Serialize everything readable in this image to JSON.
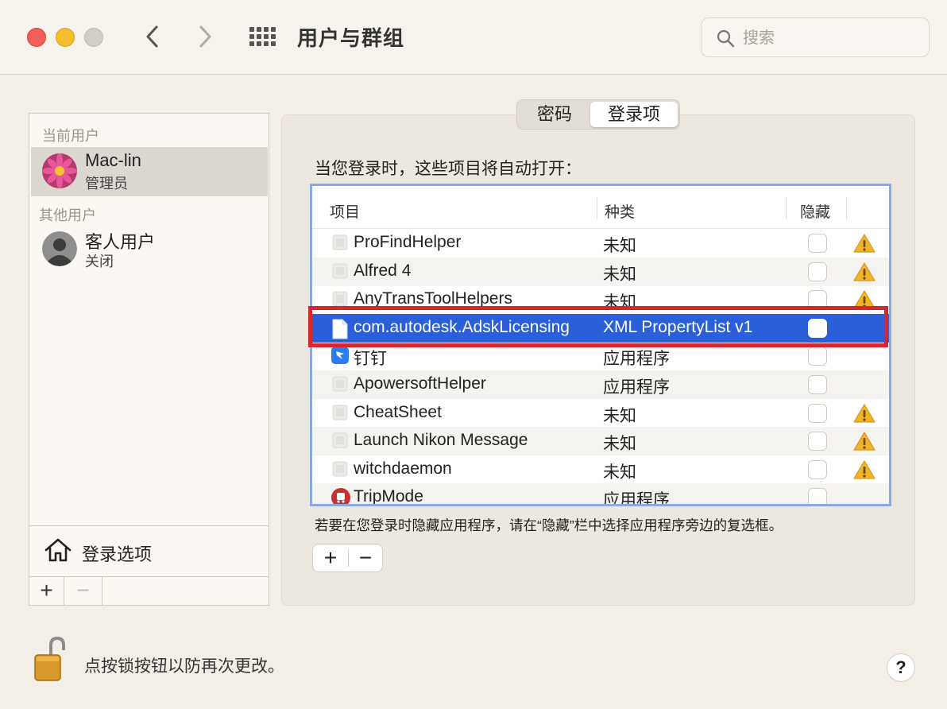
{
  "window": {
    "title": "用户与群组",
    "search_placeholder": "搜索"
  },
  "users": {
    "current_label": "当前用户",
    "current": {
      "name": "Mac-lin",
      "role": "管理员"
    },
    "other_label": "其他用户",
    "others": [
      {
        "name": "客人用户",
        "role": "关闭"
      }
    ],
    "login_options_label": "登录选项",
    "add_label": "+",
    "remove_label": "−"
  },
  "tabs": [
    {
      "label": "密码"
    },
    {
      "label": "登录项"
    }
  ],
  "active_tab": "登录项",
  "login_items": {
    "intro": "当您登录时，这些项目将自动打开：",
    "columns": {
      "item": "项目",
      "kind": "种类",
      "hide": "隐藏"
    },
    "rows": [
      {
        "name": "ProFindHelper",
        "kind": "未知",
        "icon": "generic-app-icon",
        "warning": true
      },
      {
        "name": "Alfred 4",
        "kind": "未知",
        "icon": "generic-app-icon",
        "warning": true
      },
      {
        "name": "AnyTransToolHelpers",
        "kind": "未知",
        "icon": "generic-app-icon",
        "warning": true
      },
      {
        "name": "com.autodesk.AdskLicensing",
        "kind": "XML PropertyList v1",
        "icon": "document-icon",
        "warning": false,
        "selected": true
      },
      {
        "name": "钉钉",
        "kind": "应用程序",
        "icon": "dingtalk-icon",
        "warning": false
      },
      {
        "name": "ApowersoftHelper",
        "kind": "应用程序",
        "icon": "generic-app-icon",
        "warning": false
      },
      {
        "name": "CheatSheet",
        "kind": "未知",
        "icon": "generic-app-icon",
        "warning": true
      },
      {
        "name": "Launch Nikon Message",
        "kind": "未知",
        "icon": "generic-app-icon",
        "warning": true
      },
      {
        "name": "witchdaemon",
        "kind": "未知",
        "icon": "generic-app-icon",
        "warning": true
      },
      {
        "name": "TripMode",
        "kind": "应用程序",
        "icon": "tripmode-icon",
        "warning": false
      }
    ],
    "hint": "若要在您登录时隐藏应用程序，请在“隐藏”栏中选择应用程序旁边的复选框。",
    "add_label": "+",
    "remove_label": "−"
  },
  "footer": {
    "lock_text": "点按锁按钮以防再次更改。",
    "help_label": "?"
  },
  "colors": {
    "selection": "#2b5fd9",
    "highlight_outline": "#d7262e",
    "warning": "#f0b429"
  }
}
